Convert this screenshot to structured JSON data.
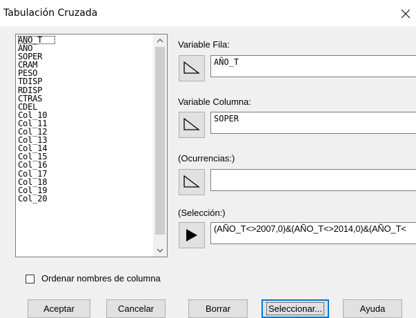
{
  "window": {
    "title": "Tabulación Cruzada",
    "close_label": "×"
  },
  "columns_list": {
    "items": [
      "AÑO_T",
      "AÑO",
      "SOPER",
      "CRAM",
      "PESO",
      "TDISP",
      "RDISP",
      "CTRAS",
      "CDEL",
      "Col_10",
      "Col_11",
      "Col_12",
      "Col_13",
      "Col_14",
      "Col_15",
      "Col_16",
      "Col_17",
      "Col_18",
      "Col_19",
      "Col_20"
    ],
    "selected_index": 0
  },
  "fields": {
    "row_variable": {
      "label": "Variable Fila:",
      "value": "AÑO_T"
    },
    "column_variable": {
      "label": "Variable Columna:",
      "value": "SOPER"
    },
    "occurrences": {
      "label": "(Ocurrencias:)",
      "value": ""
    },
    "selection": {
      "label": "(Selección:)",
      "value": "(AÑO_T<>2007,0)&(AÑO_T<>2014,0)&(AÑO_T<"
    }
  },
  "options": {
    "sort_column_names_label": "Ordenar nombres de columna",
    "sort_column_names_checked": false
  },
  "buttons": {
    "accept": "Aceptar",
    "cancel": "Cancelar",
    "clear": "Borrar",
    "select": "Seleccionar...",
    "help": "Ayuda"
  }
}
